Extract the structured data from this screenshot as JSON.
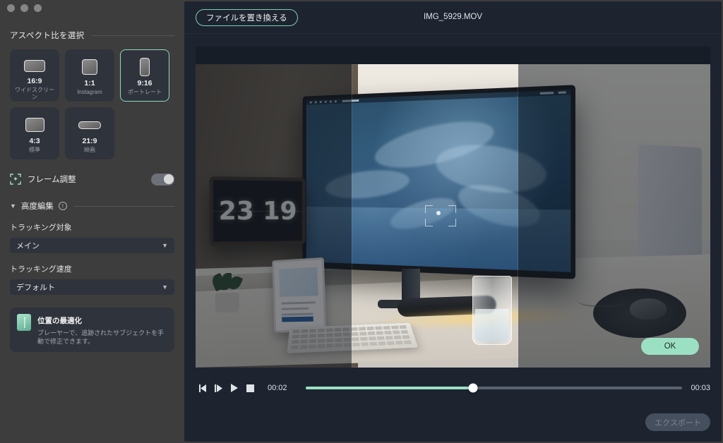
{
  "window": {
    "traffic_lights": [
      "close",
      "minimize",
      "zoom"
    ]
  },
  "sidebar": {
    "aspect_section_title": "アスペクト比を選択",
    "ratios": [
      {
        "ratio": "16:9",
        "name": "ワイドスクリーン",
        "icon": "landscape-thumb",
        "selected": false
      },
      {
        "ratio": "1:1",
        "name": "Instagram",
        "icon": "square-thumb",
        "selected": false
      },
      {
        "ratio": "9:16",
        "name": "ポートレート",
        "icon": "portrait-thumb",
        "selected": true
      },
      {
        "ratio": "4:3",
        "name": "標準",
        "icon": "standard-thumb",
        "selected": false
      },
      {
        "ratio": "21:9",
        "name": "映画",
        "icon": "cinema-thumb",
        "selected": false
      }
    ],
    "frame_adjust": {
      "label": "フレーム調整",
      "icon": "frame-adjust-icon",
      "enabled": false
    },
    "advanced": {
      "title": "高度編集",
      "chevron": "chevron-down-icon",
      "info": "info-icon",
      "tracking_target": {
        "label": "トラッキング対象",
        "value": "メイン"
      },
      "tracking_speed": {
        "label": "トラッキング速度",
        "value": "デフォルト"
      }
    },
    "tip": {
      "icon": "position-optimize-icon",
      "title": "位置の最適化",
      "body": "プレーヤーで、追跡されたサブジェクトを手動で修正できます。"
    }
  },
  "main": {
    "replace_file_label": "ファイルを置き換える",
    "file_name": "IMG_5929.MOV",
    "ok_label": "OK",
    "export_label": "エクスポート",
    "preview": {
      "clock_time": "23 19",
      "crop_overlay": "9:16 crop window",
      "tracking_marker": "subject-tracking-bracket"
    },
    "player": {
      "prev_frame_icon": "step-backward-icon",
      "next_frame_icon": "step-forward-icon",
      "play_icon": "play-icon",
      "stop_icon": "stop-icon",
      "current_time": "00:02",
      "total_time": "00:03",
      "progress_percent": 44.5
    }
  },
  "colors": {
    "accent": "#9ce0c4",
    "accent_border": "#7ecfb0",
    "panel_bg": "#1d2430",
    "sidebar_bg": "#3d3d3d",
    "card_bg": "#2f333c"
  }
}
